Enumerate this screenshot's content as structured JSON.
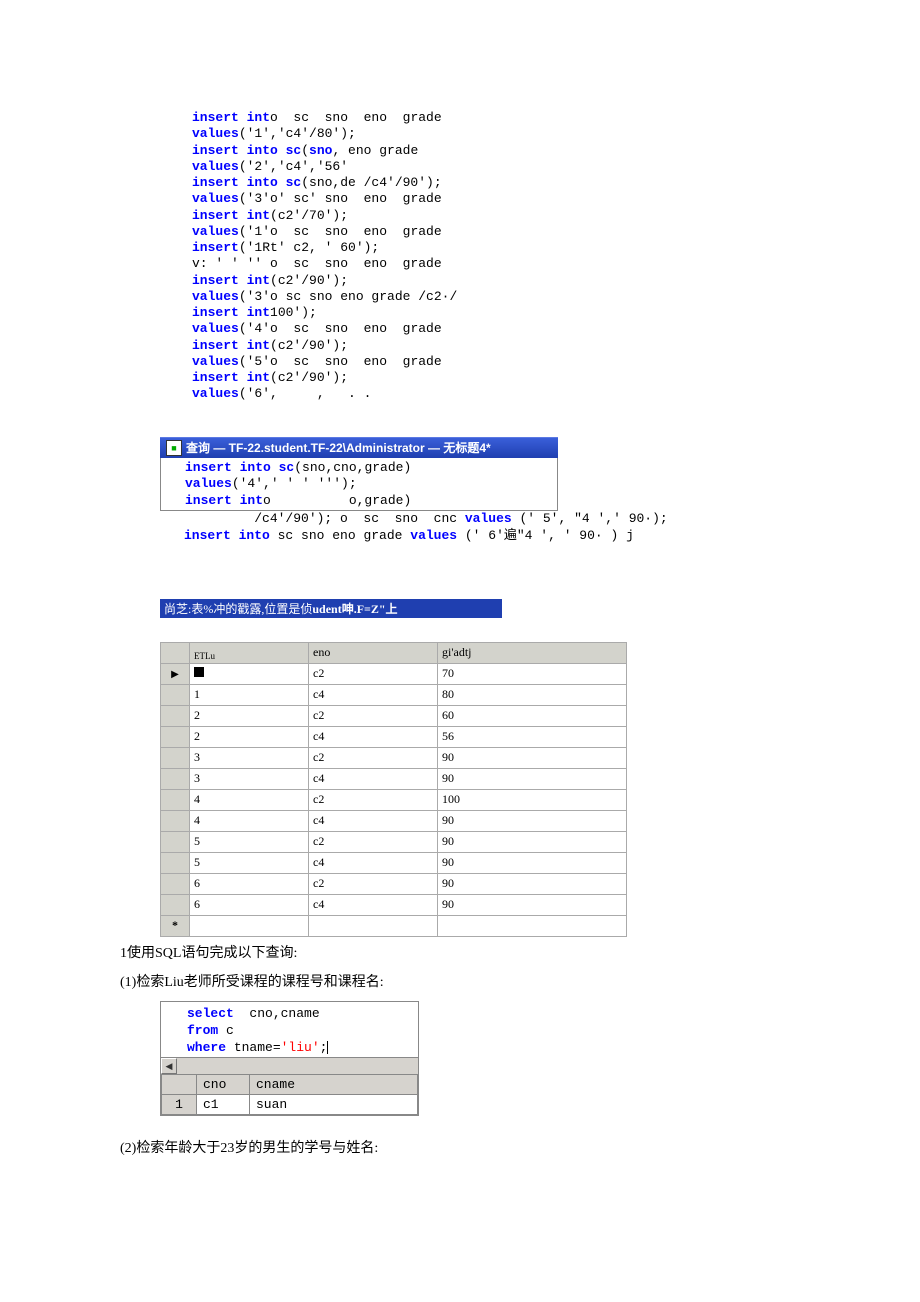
{
  "code_top": [
    [
      [
        "kw",
        "insert int"
      ],
      [
        "raw",
        "o  sc  sno  eno  grade"
      ]
    ],
    [
      [
        "kw",
        "values"
      ],
      [
        "raw",
        "('1','c4'/80');"
      ]
    ],
    [
      [
        "kw",
        "insert into sc"
      ],
      [
        "raw",
        "("
      ],
      [
        "kw",
        "sno"
      ],
      [
        "raw",
        ", eno grade"
      ]
    ],
    [
      [
        "kw",
        "values"
      ],
      [
        "raw",
        "('2','c4','56'"
      ]
    ],
    [
      [
        "kw",
        "insert into sc"
      ],
      [
        "raw",
        "(sno,de /c4'/90');"
      ]
    ],
    [
      [
        "kw",
        "values"
      ],
      [
        "raw",
        "('3'o' sc' sno  eno  grade"
      ]
    ],
    [
      [
        "kw",
        "insert int"
      ],
      [
        "raw",
        "(c2'/70');"
      ]
    ],
    [
      [
        "kw",
        "values"
      ],
      [
        "raw",
        "('1'o  sc  sno  eno  grade"
      ]
    ],
    [
      [
        "kw",
        "insert"
      ],
      [
        "raw",
        "('1Rt' c2, ' 60');"
      ]
    ],
    [
      [
        "raw",
        "v: ' ' '' o  sc  sno  eno  grade"
      ]
    ],
    [
      [
        "kw",
        "insert int"
      ],
      [
        "raw",
        "(c2'/90');"
      ]
    ],
    [
      [
        "kw",
        "values"
      ],
      [
        "raw",
        "('3'o sc sno eno grade /c2·/"
      ]
    ],
    [
      [
        "kw",
        "insert int"
      ],
      [
        "raw",
        "100');"
      ]
    ],
    [
      [
        "kw",
        "values"
      ],
      [
        "raw",
        "('4'o  sc  sno  eno  grade"
      ]
    ],
    [
      [
        "kw",
        "insert int"
      ],
      [
        "raw",
        "(c2'/90');"
      ]
    ],
    [
      [
        "kw",
        "values"
      ],
      [
        "raw",
        "('5'o  sc  sno  eno  grade"
      ]
    ],
    [
      [
        "kw",
        "insert int"
      ],
      [
        "raw",
        "(c2'/90');"
      ]
    ],
    [
      [
        "kw",
        "values"
      ],
      [
        "raw",
        "('6',     ,   . ."
      ]
    ]
  ],
  "titlebar_text": "查询 — TF-22.student.TF-22\\Administrator — 无标题4*",
  "query2": {
    "l1_a": "insert into ",
    "l1_b": "sc",
    "l1_c": "(sno,cno,grade)",
    "l2_a": "values",
    "l2_b": "('4',' ' ' ''');",
    "l3_a": "insert int",
    "l3_b": "o          o,grade)",
    "l4_a": "         /c4'/90'); o  sc  sno  cnc ",
    "l4_b": "values",
    "l4_c": " (' 5', \"4 ',' 90·);",
    "l5_a": "insert into",
    "l5_b": " sc sno eno grade ",
    "l5_c": "values",
    "l5_d": " (' 6'遍\"4 ', ' 90· ) j"
  },
  "blue_strip_prefix": "尚芝:表%冲的戳露,位置是侦",
  "blue_strip_bold": "udent呻.F=Z\"上",
  "table_headers": [
    "",
    "ETLu",
    "eno",
    "gi'adtj"
  ],
  "table_rows": [
    [
      "▶",
      "■",
      "c2",
      "70"
    ],
    [
      "",
      "1",
      "c4",
      "80"
    ],
    [
      "",
      "2",
      "c2",
      "60"
    ],
    [
      "",
      "2",
      "c4",
      "56"
    ],
    [
      "",
      "3",
      "c2",
      "90"
    ],
    [
      "",
      "3",
      "c4",
      "90"
    ],
    [
      "",
      "4",
      "c2",
      "100"
    ],
    [
      "",
      "4",
      "c4",
      "90"
    ],
    [
      "",
      "5",
      "c2",
      "90"
    ],
    [
      "",
      "5",
      "c4",
      "90"
    ],
    [
      "",
      "6",
      "c2",
      "90"
    ],
    [
      "",
      "6",
      "c4",
      "90"
    ],
    [
      "*",
      "",
      "",
      ""
    ]
  ],
  "body_line1": "1使用SQL语句完成以下查询:",
  "body_line2": "(1)检索Liu老师所受课程的课程号和课程名:",
  "sql_select": {
    "l1_a": "select",
    "l1_b": "  cno,cname",
    "l2_a": "from",
    "l2_b": " c",
    "l3_a": "where",
    "l3_b": " tname=",
    "l3_c": "'liu'",
    "l3_d": ";"
  },
  "result_headers": [
    "",
    "cno",
    "cname"
  ],
  "result_row": [
    "1",
    "c1",
    "suan"
  ],
  "body_line3": "(2)检索年龄大于23岁的男生的学号与姓名:"
}
